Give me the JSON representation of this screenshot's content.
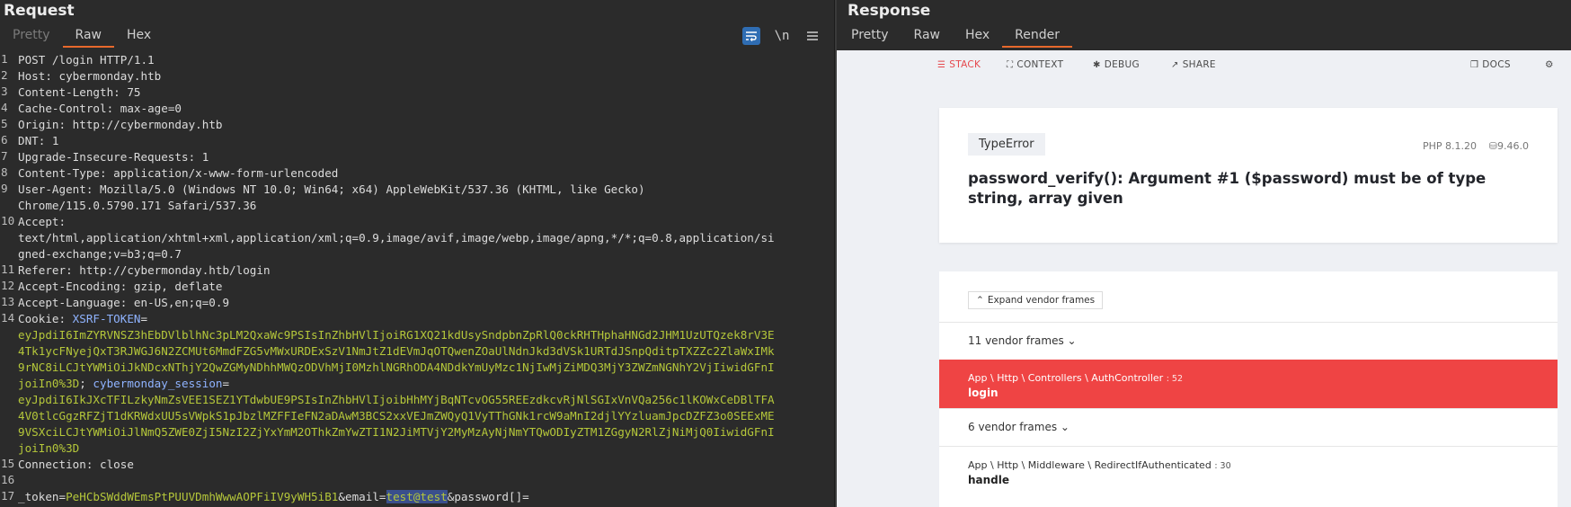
{
  "request": {
    "title": "Request",
    "tabs": [
      "Pretty",
      "Raw",
      "Hex"
    ],
    "active_tab": "Raw",
    "tools": {
      "wrap_icon": "wrap-lines-icon",
      "newline_label": "\\n",
      "menu_icon": "hamburger-menu-icon"
    },
    "lines": [
      {
        "n": "1",
        "text": "POST /login HTTP/1.1"
      },
      {
        "n": "2",
        "key": "Host",
        "value": "cybermonday.htb"
      },
      {
        "n": "3",
        "key": "Content-Length",
        "value": "75"
      },
      {
        "n": "4",
        "key": "Cache-Control",
        "value": "max-age=0"
      },
      {
        "n": "5",
        "key": "Origin",
        "value": "http://cybermonday.htb"
      },
      {
        "n": "6",
        "key": "DNT",
        "value": "1"
      },
      {
        "n": "7",
        "key": "Upgrade-Insecure-Requests",
        "value": "1"
      },
      {
        "n": "8",
        "key": "Content-Type",
        "value": "application/x-www-form-urlencoded"
      },
      {
        "n": "9",
        "key": "User-Agent",
        "value": "Mozilla/5.0 (Windows NT 10.0; Win64; x64) AppleWebKit/537.36 (KHTML, like Gecko)",
        "cont": [
          "Chrome/115.0.5790.171 Safari/537.36"
        ]
      },
      {
        "n": "10",
        "key": "Accept",
        "value": "",
        "cont": [
          "text/html,application/xhtml+xml,application/xml;q=0.9,image/avif,image/webp,image/apng,*/*;q=0.8,application/si",
          "gned-exchange;v=b3;q=0.7"
        ]
      },
      {
        "n": "11",
        "key": "Referer",
        "value": "http://cybermonday.htb/login"
      },
      {
        "n": "12",
        "key": "Accept-Encoding",
        "value": "gzip, deflate"
      },
      {
        "n": "13",
        "key": "Accept-Language",
        "value": "en-US,en;q=0.9"
      },
      {
        "n": "14",
        "key": "Cookie",
        "value": ""
      },
      {
        "n": "15",
        "key": "Connection",
        "value": "close"
      },
      {
        "n": "16",
        "text": ""
      },
      {
        "n": "17",
        "text": ""
      }
    ],
    "cookie": {
      "xsrf_name": "XSRF-TOKEN",
      "xsrf_lines": [
        "eyJpdiI6ImZYRVNSZ3hEbDVlblhNc3pLM2QxaWc9PSIsInZhbHVlIjoiRG1XQ21kdUsySndpbnZpRlQ0ckRHTHphaHNGd2JHM1UzUTQzek8rV3E",
        "4Tk1ycFNyejQxT3RJWGJ6N2ZCMUt6MmdFZG5vMWxURDExSzV1NmJtZ1dEVmJqOTQwenZOaUlNdnJkd3dVSk1URTdJSnpQditpTXZZc2ZlaWxIMk",
        "9rNC8iLCJtYWMiOiJkNDcxNThjY2QwZGMyNDhhMWQzODVhMjI0MzhlNGRhODA4NDdkYmUyMzc1NjIwMjZiMDQ3MjY3ZWZmNGNhY2VjIiwidGFnI",
        "joiIn0%3D"
      ],
      "sep": "; ",
      "session_name": "cybermonday_session",
      "session_lines": [
        "eyJpdiI6IkJXcTFILzkyNmZsVEE1SEZ1YTdwbUE9PSIsInZhbHVlIjoibHhMYjBqNTcvOG55REEzdkcvRjNlSGIxVnVQa256c1lKOWxCeDBlTFA",
        "4V0tlcGgzRFZjT1dKRWdxUU5sVWpkS1pJbzlMZFFIeFN2aDAwM3BCS2xxVEJmZWQyQ1VyTThGNk1rcW9aMnI2djlYYzluamJpcDZFZ3o0SEExME",
        "9VSXciLCJtYWMiOiJlNmQ5ZWE0ZjI5NzI2ZjYxYmM2OThkZmYwZTI1N2JiMTVjY2MyMzAyNjNmYTQwODIyZTM1ZGgyN2RlZjNiMjQ0IiwidGFnI",
        "joiIn0%3D"
      ]
    },
    "body_line": {
      "k1": "_token",
      "v1": "PeHCbSWddWEmsPtPUUVDmhWwwAOPFiIV9yWH5iB1",
      "k2": "email",
      "v2": "test@test",
      "k3": "password[]",
      "v3": ""
    }
  },
  "response": {
    "title": "Response",
    "tabs": [
      "Pretty",
      "Raw",
      "Hex",
      "Render"
    ],
    "active_tab": "Render",
    "render": {
      "bar": {
        "stack": "STACK",
        "context": "CONTEXT",
        "debug": "DEBUG",
        "share": "SHARE",
        "docs": "DOCS"
      },
      "exception_class": "TypeError",
      "php_version": "PHP 8.1.20",
      "laravel_version": "9.46.0",
      "message": "password_verify(): Argument #1 ($password) must be of type string, array given",
      "expand_label": "Expand vendor frames",
      "frames": [
        {
          "kind": "vendor",
          "label": "11 vendor frames"
        },
        {
          "kind": "app",
          "path": "App \\ Http \\ Controllers \\ AuthController",
          "line": ": 52",
          "fn": "login",
          "active": true
        },
        {
          "kind": "vendor",
          "label": "6 vendor frames"
        },
        {
          "kind": "app",
          "path": "App \\ Http \\ Middleware \\ RedirectIfAuthenticated",
          "line": ": 30",
          "fn": "handle",
          "active": false
        }
      ]
    }
  },
  "colors": {
    "accent": "#e8692c",
    "error_red": "#ef4444",
    "cookie_name": "#8fb3ff",
    "cookie_value": "#b5c73a"
  }
}
